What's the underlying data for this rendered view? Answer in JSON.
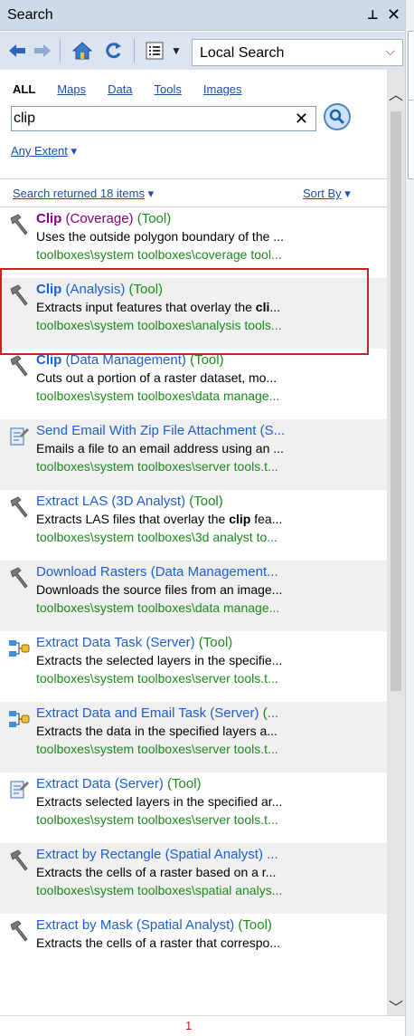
{
  "window": {
    "title": "Search",
    "pin_glyph": "⊥",
    "close_glyph": "✕"
  },
  "toolbar": {
    "back_icon": "back-arrow-icon",
    "forward_icon": "forward-arrow-icon",
    "home_icon": "home-icon",
    "refresh_icon": "refresh-icon",
    "options_icon": "list-options-icon",
    "search_location": "Local Search"
  },
  "categories": [
    {
      "label": "ALL",
      "active": true
    },
    {
      "label": "Maps",
      "active": false
    },
    {
      "label": "Data",
      "active": false
    },
    {
      "label": "Tools",
      "active": false
    },
    {
      "label": "Images",
      "active": false
    }
  ],
  "search": {
    "value": "clip",
    "clear_glyph": "✕"
  },
  "extent": {
    "label": "Any Extent",
    "caret": "▾"
  },
  "results_bar": {
    "count_text": "Search returned 18 items",
    "sort_label": "Sort By",
    "caret": "▾"
  },
  "results": [
    {
      "icon": "hammer-tool-icon",
      "prefix": "",
      "bold": "Clip",
      "rest": " (Coverage)",
      "kind": " (Tool)",
      "visited": true,
      "desc": [
        "Uses the outside polygon boundary of the ...",
        "",
        ""
      ],
      "path": "toolboxes\\system toolboxes\\coverage tool..."
    },
    {
      "icon": "hammer-tool-icon",
      "prefix": "",
      "bold": "Clip",
      "rest": " (Analysis)",
      "kind": " (Tool)",
      "visited": false,
      "desc": [
        "Extracts input features that overlay the ",
        "cli",
        "..."
      ],
      "path": "toolboxes\\system toolboxes\\analysis tools..."
    },
    {
      "icon": "hammer-tool-icon",
      "prefix": "",
      "bold": "Clip",
      "rest": " (Data Management)",
      "kind": " (Tool)",
      "visited": false,
      "desc": [
        "Cuts out a portion of a raster dataset, mo...",
        "",
        ""
      ],
      "path": "toolboxes\\system toolboxes\\data manage..."
    },
    {
      "icon": "script-tool-icon",
      "prefix": "Send Email With Zip File Attachment (S...",
      "bold": "",
      "rest": "",
      "kind": "",
      "visited": false,
      "desc": [
        "Emails a file to an email address using an ...",
        "",
        ""
      ],
      "path": "toolboxes\\system toolboxes\\server tools.t..."
    },
    {
      "icon": "hammer-tool-icon",
      "prefix": "Extract LAS (3D Analyst)",
      "bold": "",
      "rest": "",
      "kind": " (Tool)",
      "visited": false,
      "desc": [
        "Extracts LAS files that overlay the ",
        "clip",
        " fea..."
      ],
      "path": "toolboxes\\system toolboxes\\3d analyst to..."
    },
    {
      "icon": "hammer-tool-icon",
      "prefix": "Download Rasters (Data Management...",
      "bold": "",
      "rest": "",
      "kind": "",
      "visited": false,
      "desc": [
        "Downloads the source files from an image...",
        "",
        ""
      ],
      "path": "toolboxes\\system toolboxes\\data manage..."
    },
    {
      "icon": "model-tool-icon",
      "prefix": "Extract Data Task (Server)",
      "bold": "",
      "rest": "",
      "kind": " (Tool)",
      "visited": false,
      "desc": [
        "Extracts the selected layers in the specifie...",
        "",
        ""
      ],
      "path": "toolboxes\\system toolboxes\\server tools.t..."
    },
    {
      "icon": "model-tool-icon",
      "prefix": "Extract Data and Email Task (Server)",
      "bold": "",
      "rest": "",
      "kind": " (...",
      "visited": false,
      "desc": [
        "Extracts the data in the specified layers a...",
        "",
        ""
      ],
      "path": "toolboxes\\system toolboxes\\server tools.t..."
    },
    {
      "icon": "script-tool-icon",
      "prefix": "Extract Data (Server)",
      "bold": "",
      "rest": "",
      "kind": " (Tool)",
      "visited": false,
      "desc": [
        "Extracts selected layers in the specified ar...",
        "",
        ""
      ],
      "path": "toolboxes\\system toolboxes\\server tools.t..."
    },
    {
      "icon": "hammer-tool-icon",
      "prefix": "Extract by Rectangle (Spatial Analyst) ...",
      "bold": "",
      "rest": "",
      "kind": "",
      "visited": false,
      "desc": [
        "Extracts the cells of a raster based on a r...",
        "",
        ""
      ],
      "path": "toolboxes\\system toolboxes\\spatial analys..."
    },
    {
      "icon": "hammer-tool-icon",
      "prefix": "Extract by Mask (Spatial Analyst)",
      "bold": "",
      "rest": "",
      "kind": " (Tool)",
      "visited": false,
      "desc": [
        "Extracts the cells of a raster that correspo...",
        "",
        ""
      ],
      "path": ""
    }
  ],
  "pager": {
    "current_page": "1"
  }
}
